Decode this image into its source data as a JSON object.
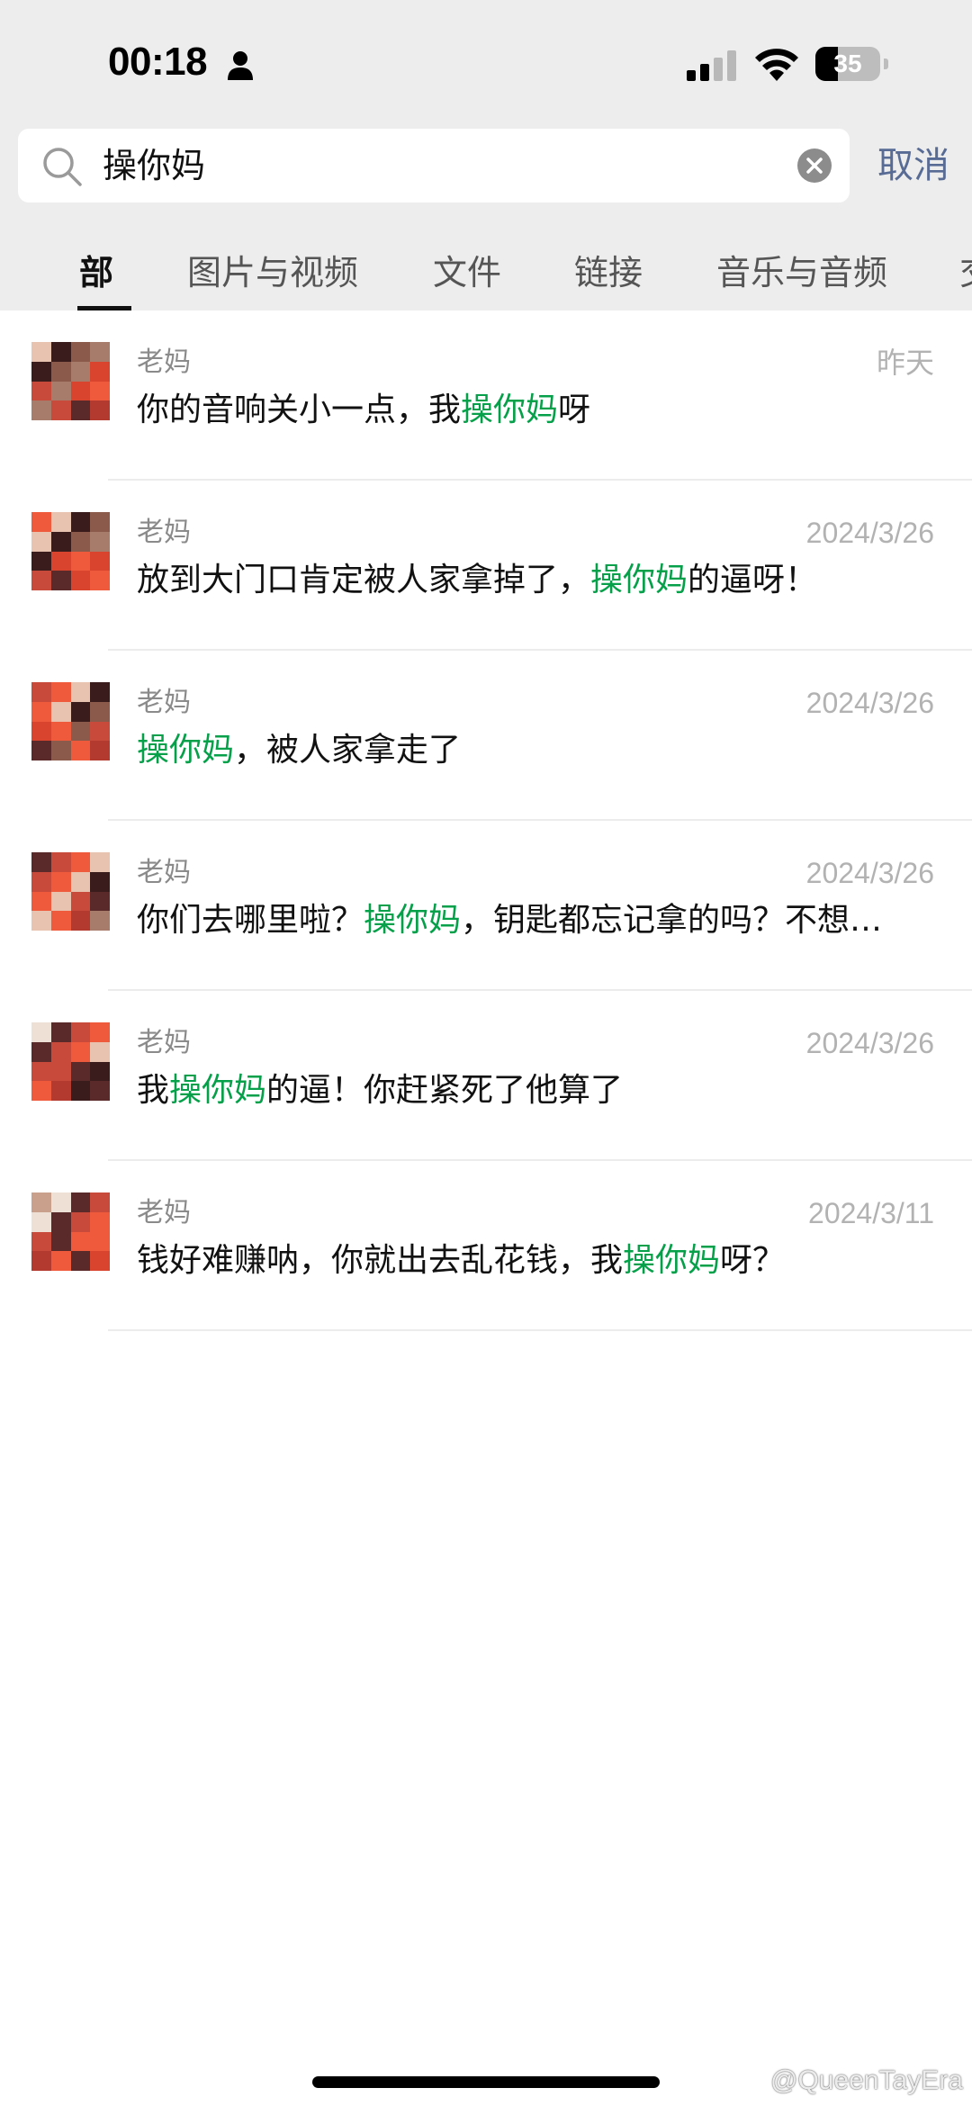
{
  "status_bar": {
    "time": "00:18",
    "battery": "35",
    "battery_level": 0.35
  },
  "search": {
    "query": "操你妈",
    "cancel_label": "取消"
  },
  "tabs": [
    {
      "label": "部",
      "active": true
    },
    {
      "label": "图片与视频",
      "active": false
    },
    {
      "label": "文件",
      "active": false
    },
    {
      "label": "链接",
      "active": false
    },
    {
      "label": "音乐与音频",
      "active": false
    },
    {
      "label": "交",
      "active": false
    }
  ],
  "results": [
    {
      "sender": "老妈",
      "date": "昨天",
      "pre": "你的音响关小一点，我",
      "hl": "操你妈",
      "post": "呀"
    },
    {
      "sender": "老妈",
      "date": "2024/3/26",
      "pre": "放到大门口肯定被人家拿掉了，",
      "hl": "操你妈",
      "post": "的逼呀！"
    },
    {
      "sender": "老妈",
      "date": "2024/3/26",
      "pre": "",
      "hl": "操你妈",
      "post": "，被人家拿走了"
    },
    {
      "sender": "老妈",
      "date": "2024/3/26",
      "pre": "你们去哪里啦？",
      "hl": "操你妈",
      "post": "，钥匙都忘记拿的吗？不想…"
    },
    {
      "sender": "老妈",
      "date": "2024/3/26",
      "pre": "我",
      "hl": "操你妈",
      "post": "的逼！你赶紧死了他算了"
    },
    {
      "sender": "老妈",
      "date": "2024/3/11",
      "pre": "钱好难赚呐，你就出去乱花钱，我",
      "hl": "操你妈",
      "post": "呀？"
    }
  ],
  "watermark": "@QueenTayEra",
  "colors": {
    "highlight": "#07a04a",
    "link": "#576b95",
    "header_bg": "#ededed"
  },
  "icons": [
    "person-icon",
    "signal-icon",
    "wifi-icon",
    "search-icon",
    "clear-icon",
    "weibo-icon"
  ]
}
